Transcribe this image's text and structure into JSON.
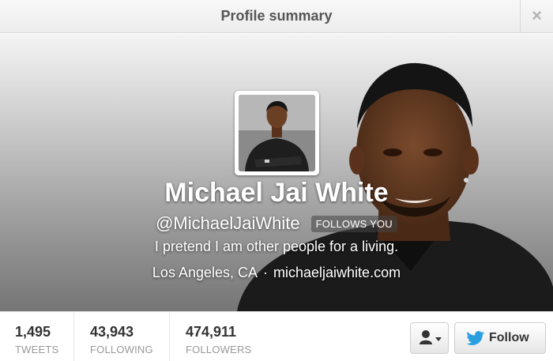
{
  "dialog": {
    "title": "Profile summary",
    "close_icon": "close-icon",
    "close_glyph": "×"
  },
  "profile": {
    "name": "Michael Jai White",
    "handle": "@MichaelJaiWhite",
    "follows_you_badge": "FOLLOWS YOU",
    "bio": "I pretend I am other people for a living.",
    "location": "Los Angeles, CA",
    "separator": "·",
    "website": "michaeljaiwhite.com"
  },
  "stats": [
    {
      "value": "1,495",
      "label": "TWEETS"
    },
    {
      "value": "43,943",
      "label": "FOLLOWING"
    },
    {
      "value": "474,911",
      "label": "FOLLOWERS"
    }
  ],
  "actions": {
    "user_actions_icon": "person-dropdown-icon",
    "follow_label": "Follow",
    "follow_icon": "bird-icon"
  },
  "colors": {
    "twitter_blue": "#2a9fe0",
    "text_dark": "#333333",
    "text_muted": "#999999"
  }
}
